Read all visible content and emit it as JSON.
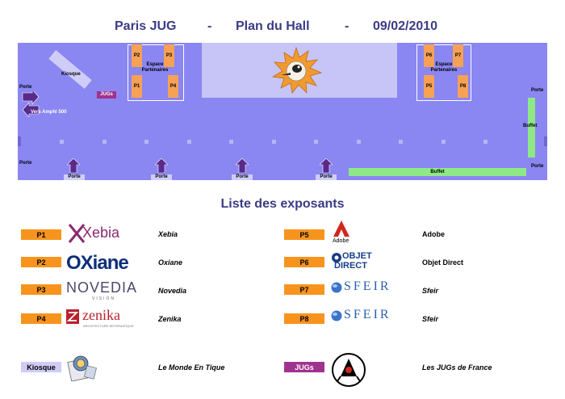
{
  "header": {
    "org": "Paris JUG",
    "sep": "-",
    "plan": "Plan du Hall",
    "date": "09/02/2010"
  },
  "hall": {
    "kiosque_label": "Kiosque",
    "jugs_label": "JUGs",
    "porte_label": "Porte",
    "vers_amphi": "Vers Amphi 500",
    "buffet_label": "Buffet",
    "espace_line1": "Espace",
    "espace_line2": "Partenaires",
    "stands": [
      "P1",
      "P2",
      "P3",
      "P4",
      "P5",
      "P6",
      "P7",
      "P8"
    ]
  },
  "list": {
    "title": "Liste des exposants",
    "left": [
      {
        "badge": "P1",
        "logo": "Xebia",
        "name": "Xebia"
      },
      {
        "badge": "P2",
        "logo": "OXiane",
        "name": "Oxiane"
      },
      {
        "badge": "P3",
        "logo": "NOVEDIA",
        "logo_sub": "VISION",
        "name": "Novedia"
      },
      {
        "badge": "P4",
        "logo": "zenika",
        "logo_sub": "ARCHITECTURE INFORMATIQUE",
        "name": "Zenika"
      }
    ],
    "right": [
      {
        "badge": "P5",
        "logo": "Adobe",
        "name": "Adobe"
      },
      {
        "badge": "P6",
        "logo": "OBJET",
        "logo_sub": "DIRECT",
        "name": "Objet Direct"
      },
      {
        "badge": "P7",
        "logo": "SFEIR",
        "name": "Sfeir"
      },
      {
        "badge": "P8",
        "logo": "SFEIR",
        "name": "Sfeir"
      }
    ],
    "kiosque": {
      "badge": "Kiosque",
      "name": "Le Monde En Tique"
    },
    "jugs": {
      "badge": "JUGs",
      "name": "Les JUGs de France"
    }
  },
  "colors": {
    "hall_bg": "#8a86f2",
    "stand": "#f7a155",
    "badge": "#f7941d",
    "buffet": "#8fe886",
    "title": "#3b3b84",
    "jugs": "#a0338f"
  }
}
